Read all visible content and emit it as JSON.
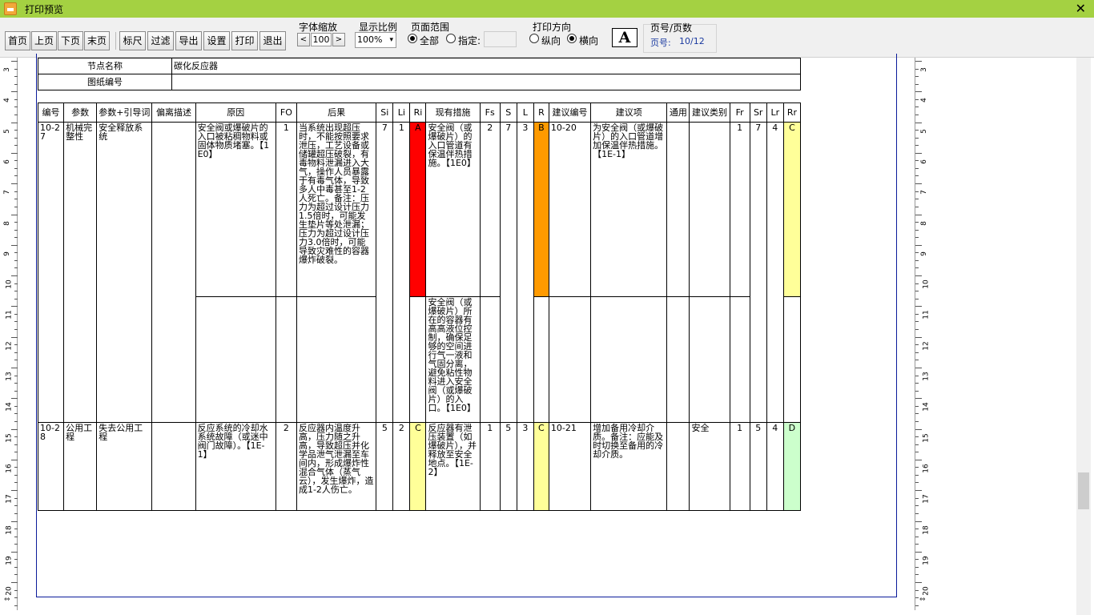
{
  "window": {
    "title": "打印预览",
    "close_glyph": "✕"
  },
  "toolbar": {
    "first": "首页",
    "prev": "上页",
    "next": "下页",
    "last": "末页",
    "ruler": "标尺",
    "filter": "过滤",
    "export": "导出",
    "settings": "设置",
    "print": "打印",
    "exit": "退出",
    "font_zoom_label": "字体缩放",
    "font_zoom_dec": "<",
    "font_zoom_value": "100",
    "font_zoom_inc": ">",
    "scale_label": "显示比例",
    "scale_value": "100%",
    "range_label": "页面范围",
    "range_all": "全部",
    "range_specified": "指定:",
    "orient_label": "打印方向",
    "orient_portrait": "纵向",
    "orient_landscape": "横向",
    "font_button": "A",
    "page_label": "页号/页数",
    "page_prefix": "页号:",
    "page_value": "10/12"
  },
  "ruler": {
    "left_numbers": [
      "3",
      "4",
      "5",
      "6",
      "7",
      "8",
      "9",
      "10",
      "11",
      "12",
      "13",
      "14",
      "15",
      "16",
      "17",
      "18",
      "19",
      "20"
    ],
    "right_numbers": [
      "3",
      "4",
      "5",
      "6",
      "7",
      "8",
      "9",
      "10",
      "11",
      "12",
      "13",
      "14",
      "15",
      "16",
      "17",
      "18",
      "19",
      "20"
    ]
  },
  "header": {
    "node_name_label": "节点名称",
    "node_name_value": "碳化反应器",
    "drawing_no_label": "图纸编号",
    "drawing_no_value": ""
  },
  "columns": [
    "编号",
    "参数",
    "参数+引导词",
    "偏离描述",
    "原因",
    "FO",
    "后果",
    "Si",
    "Li",
    "Ri",
    "现有措施",
    "Fs",
    "S",
    "L",
    "R",
    "建议编号",
    "建议项",
    "通用",
    "建议类别",
    "Fr",
    "Sr",
    "Lr",
    "Rr"
  ],
  "rows": [
    {
      "id": "10-27",
      "param": "机械完整性",
      "param_guide": "安全释放系统",
      "deviation": "",
      "cause": "安全阀或爆破片的入口被粘稠物料或固体物质堵塞。【1E0】",
      "fo": "1",
      "consequence": "当系统出现超压时，不能按照要求泄压，工艺设备或储罐超压破裂，有毒物料泄漏进入大气，操作人员暴露于有毒气体，导致多人中毒甚至1-2人死亡。备注：压力为超过设计压力1.5倍时，可能发生垫片等处泄漏；压力为超过设计压力3.0倍时，可能导致灾难性的容器爆炸破裂。",
      "si": "7",
      "li": "1",
      "ri": "A",
      "measure1": "安全阀（或爆破片）的入口管道有保温伴热措施。【1E0】",
      "fs1": "2",
      "s": "7",
      "l": "3",
      "r": "B",
      "sugg_no": "10-20",
      "sugg": "为安全阀（或爆破片）的入口管道增加保温伴热措施。【1E-1】",
      "general": "",
      "category": "",
      "fr": "1",
      "sr": "7",
      "lr": "4",
      "rr": "C",
      "measure2": "安全阀（或爆破片）所在的容器有高高液位控制，确保足够的空间进行气一液和气固分离，避免粘性物料进入安全阀（或爆破片）的入口。【1E0】"
    },
    {
      "id": "10-28",
      "param": "公用工程",
      "param_guide": "失去公用工程",
      "deviation": "",
      "cause": "反应系统的冷却水系统故障（或迷中阀门故障）。【1E-1】",
      "fo": "2",
      "consequence": "反应器内温度升高，压力随之升高，导致超压并化学品泄气泄漏至车间内，形成爆炸性混合气体（蒸气云），发生爆炸，造成1-2人伤亡。",
      "si": "5",
      "li": "2",
      "ri": "C",
      "measure1": "反应器有泄压装置（如爆破片），并释放至安全地点。【1E-2】",
      "fs1": "1",
      "s": "5",
      "l": "3",
      "r": "C",
      "sugg_no": "10-21",
      "sugg": "增加备用冷却介质。备注：应能及时切换至备用的冷却介质。",
      "general": "",
      "category": "安全",
      "fr": "1",
      "sr": "5",
      "lr": "4",
      "rr": "D"
    }
  ],
  "colors": {
    "risk_A": "#ff0000",
    "risk_B": "#ff9a00",
    "risk_C": "#ffff99",
    "risk_D": "#ccffcc",
    "titlebar": "#a4d142",
    "page_border": "#0b1b9a"
  }
}
